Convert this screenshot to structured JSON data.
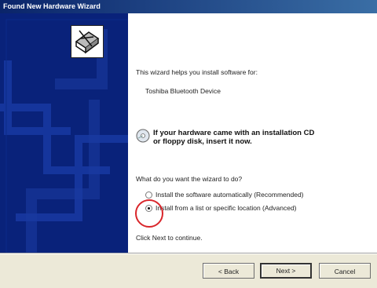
{
  "window": {
    "title": "Found New Hardware Wizard"
  },
  "content": {
    "intro": "This wizard helps you install software for:",
    "device_name": "Toshiba Bluetooth Device",
    "cd_hint_line1": "If your hardware came with an installation CD",
    "cd_hint_line2": "or floppy disk, insert it now.",
    "question": "What do you want the wizard to do?",
    "options": [
      {
        "label": "Install the software automatically (Recommended)",
        "selected": false
      },
      {
        "label": "Install from a list or specific location (Advanced)",
        "selected": true
      }
    ],
    "continue_hint": "Click Next to continue."
  },
  "buttons": {
    "back": "< Back",
    "next": "Next >",
    "cancel": "Cancel"
  },
  "colors": {
    "title_bar": "#0a246a",
    "left_panel": "#09227a",
    "highlight_circle": "#d9262b"
  },
  "icons": {
    "hardware": "hardware-wizard-icon",
    "cd": "cd-icon"
  }
}
